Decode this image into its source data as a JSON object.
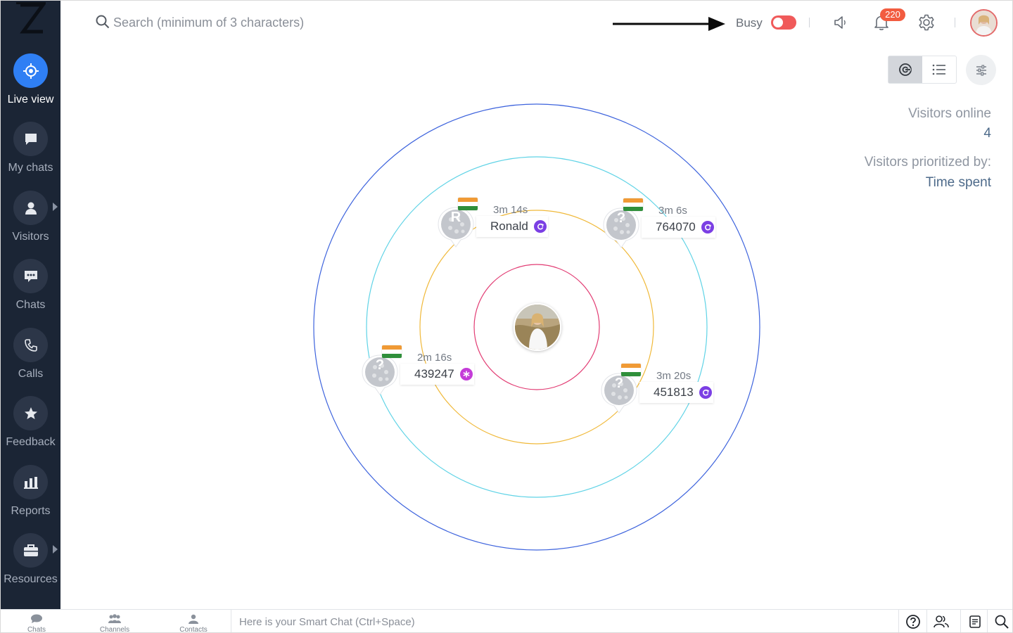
{
  "sidebar": {
    "items": [
      {
        "label": "Live view",
        "icon": "target-icon",
        "active": true
      },
      {
        "label": "My chats",
        "icon": "chat-bubble-icon"
      },
      {
        "label": "Visitors",
        "icon": "person-icon",
        "has_submenu": true
      },
      {
        "label": "Chats",
        "icon": "chat-dots-icon"
      },
      {
        "label": "Calls",
        "icon": "phone-icon"
      },
      {
        "label": "Feedback",
        "icon": "star-icon"
      },
      {
        "label": "Reports",
        "icon": "bar-chart-icon"
      },
      {
        "label": "Resources",
        "icon": "briefcase-icon",
        "has_submenu": true
      }
    ]
  },
  "header": {
    "search_placeholder": "Search (minimum of 3 characters)",
    "status_label": "Busy",
    "notification_count": "220"
  },
  "stats": {
    "online_label": "Visitors online",
    "online_count": "4",
    "priority_label": "Visitors prioritized by:",
    "priority_value": "Time spent"
  },
  "visitors": [
    {
      "name": "Ronald",
      "time": "3m 14s",
      "avatar_letter": "R",
      "status": "returning"
    },
    {
      "name": "764070",
      "time": "3m 6s",
      "avatar_letter": "?",
      "status": "returning"
    },
    {
      "name": "439247",
      "time": "2m 16s",
      "avatar_letter": "?",
      "status": "new"
    },
    {
      "name": "451813",
      "time": "3m 20s",
      "avatar_letter": "?",
      "status": "returning"
    }
  ],
  "bottom": {
    "tabs": [
      {
        "label": "Chats"
      },
      {
        "label": "Channels"
      },
      {
        "label": "Contacts"
      }
    ],
    "smart_chat_placeholder": "Here is your Smart Chat (Ctrl+Space)"
  },
  "colors": {
    "sidebar_bg": "#1b2535",
    "active_blue": "#2f7ff4",
    "busy_red": "#f05a5a",
    "badge_orange": "#f25c40",
    "ring_outer": "#3d63dd",
    "ring_cyan": "#5fd3e6",
    "ring_orange": "#f0b93a",
    "ring_pink": "#e23d74",
    "status_purple": "#7b3fe4",
    "status_magenta": "#c43cd8"
  }
}
